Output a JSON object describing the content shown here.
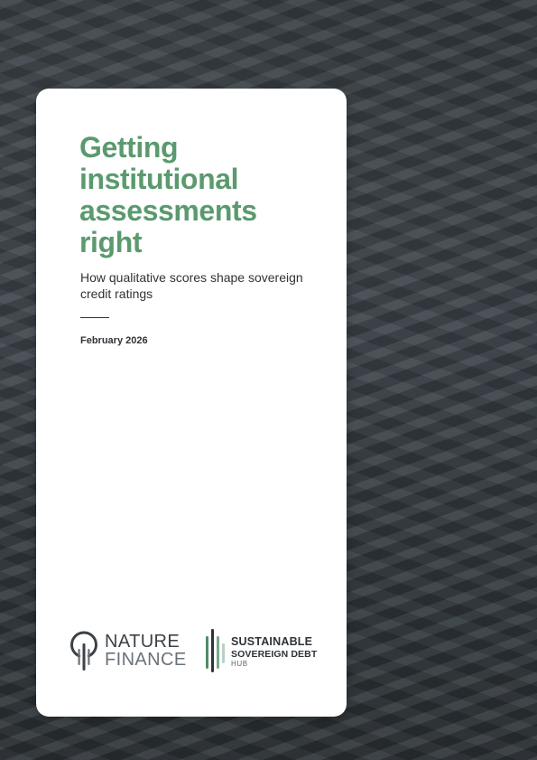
{
  "document": {
    "title": "Getting institutional assessments right",
    "subtitle": "How qualitative scores shape sovereign credit ratings",
    "date": "February 2026"
  },
  "logos": {
    "nature_finance": {
      "line1": "NATURE",
      "line2": "FINANCE"
    },
    "sustainable_sovereign_debt_hub": {
      "line1": "SUSTAINABLE",
      "line2": "SOVEREIGN DEBT",
      "line3": "HUB"
    }
  },
  "colors": {
    "title_green": "#5a9a6e",
    "text_dark": "#2f3337",
    "background_dark": "#3a4248",
    "card_white": "#ffffff"
  }
}
